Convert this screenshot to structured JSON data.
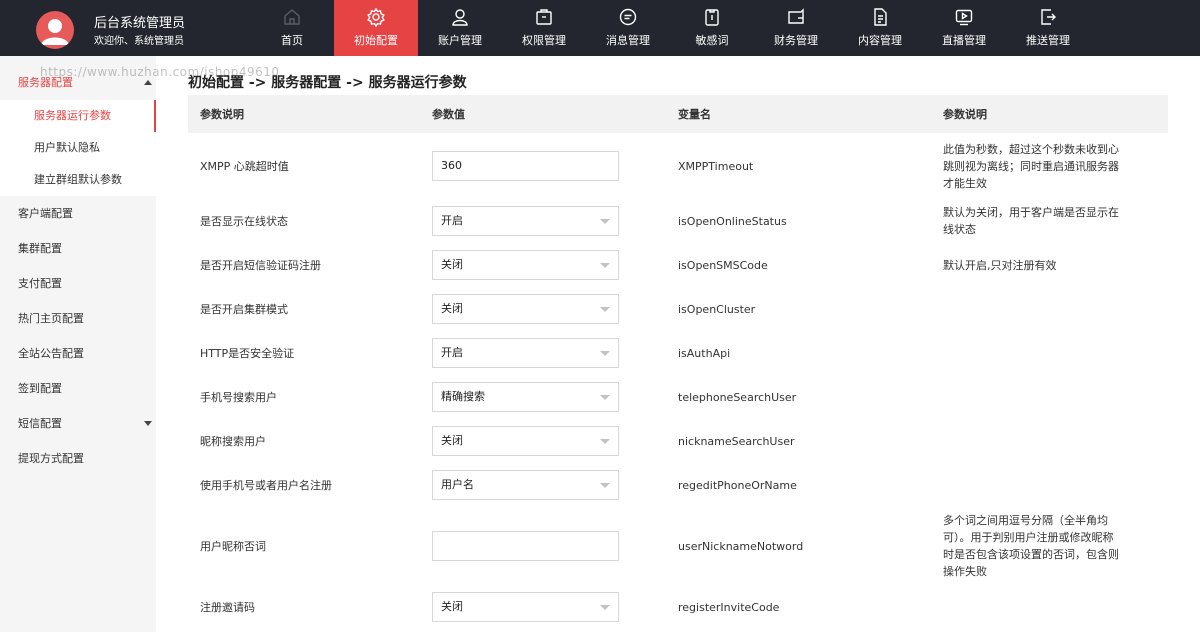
{
  "header": {
    "title": "后台系统管理员",
    "welcome": "欢迎你、系统管理员"
  },
  "nav": [
    {
      "label": "首页",
      "icon": "home-icon",
      "active": false
    },
    {
      "label": "初始配置",
      "icon": "gear-icon",
      "active": true
    },
    {
      "label": "账户管理",
      "icon": "user-icon",
      "active": false
    },
    {
      "label": "权限管理",
      "icon": "briefcase-icon",
      "active": false
    },
    {
      "label": "消息管理",
      "icon": "chat-icon",
      "active": false
    },
    {
      "label": "敏感词",
      "icon": "clipboard-icon",
      "active": false
    },
    {
      "label": "财务管理",
      "icon": "wallet-icon",
      "active": false
    },
    {
      "label": "内容管理",
      "icon": "document-icon",
      "active": false
    },
    {
      "label": "直播管理",
      "icon": "tv-icon",
      "active": false
    },
    {
      "label": "推送管理",
      "icon": "export-icon",
      "active": false
    }
  ],
  "sidebar": {
    "open_group": "服务器配置",
    "sub_items": [
      "服务器运行参数",
      "用户默认隐私",
      "建立群组默认参数"
    ],
    "groups": [
      "客户端配置",
      "集群配置",
      "支付配置",
      "热门主页配置",
      "全站公告配置",
      "签到配置",
      "短信配置",
      "提现方式配置"
    ]
  },
  "watermark": "https://www.huzhan.com/ishop49610",
  "breadcrumb": "初始配置 -> 服务器配置 -> 服务器运行参数",
  "table": {
    "headers": [
      "参数说明",
      "参数值",
      "变量名",
      "参数说明"
    ],
    "rows": [
      {
        "label": "XMPP 心跳超时值",
        "value": "360",
        "type": "input",
        "var": "XMPPTimeout",
        "desc": [
          "此值为秒数，超过这个秒数未收到心",
          "跳则视为离线；同时重启通讯服务器",
          "才能生效"
        ]
      },
      {
        "label": "是否显示在线状态",
        "value": "开启",
        "type": "select",
        "var": "isOpenOnlineStatus",
        "desc": [
          "默认为关闭，用于客户端是否显示在",
          "线状态"
        ]
      },
      {
        "label": "是否开启短信验证码注册",
        "value": "关闭",
        "type": "select",
        "var": "isOpenSMSCode",
        "desc": [
          "默认开启,只对注册有效"
        ]
      },
      {
        "label": "是否开启集群模式",
        "value": "关闭",
        "type": "select",
        "var": "isOpenCluster",
        "desc": []
      },
      {
        "label": "HTTP是否安全验证",
        "value": "开启",
        "type": "select",
        "var": "isAuthApi",
        "desc": []
      },
      {
        "label": "手机号搜索用户",
        "value": "精确搜索",
        "type": "select",
        "var": "telephoneSearchUser",
        "desc": []
      },
      {
        "label": "昵称搜索用户",
        "value": "关闭",
        "type": "select",
        "var": "nicknameSearchUser",
        "desc": []
      },
      {
        "label": "使用手机号或者用户名注册",
        "value": "用户名",
        "type": "select",
        "var": "regeditPhoneOrName",
        "desc": []
      },
      {
        "label": "用户昵称否词",
        "value": "",
        "type": "input",
        "var": "userNicknameNotword",
        "desc": [
          "多个词之间用逗号分隔（全半角均",
          "可）。用于判别用户注册或修改昵称",
          "时是否包含该项设置的否词，包含则",
          "操作失败"
        ]
      },
      {
        "label": "注册邀请码",
        "value": "关闭",
        "type": "select",
        "var": "registerInviteCode",
        "desc": []
      }
    ]
  },
  "colors": {
    "topbar": "#23262e",
    "accent": "#e64444",
    "sidebar": "#f5f5f5",
    "header_row": "#f2f2f2"
  }
}
